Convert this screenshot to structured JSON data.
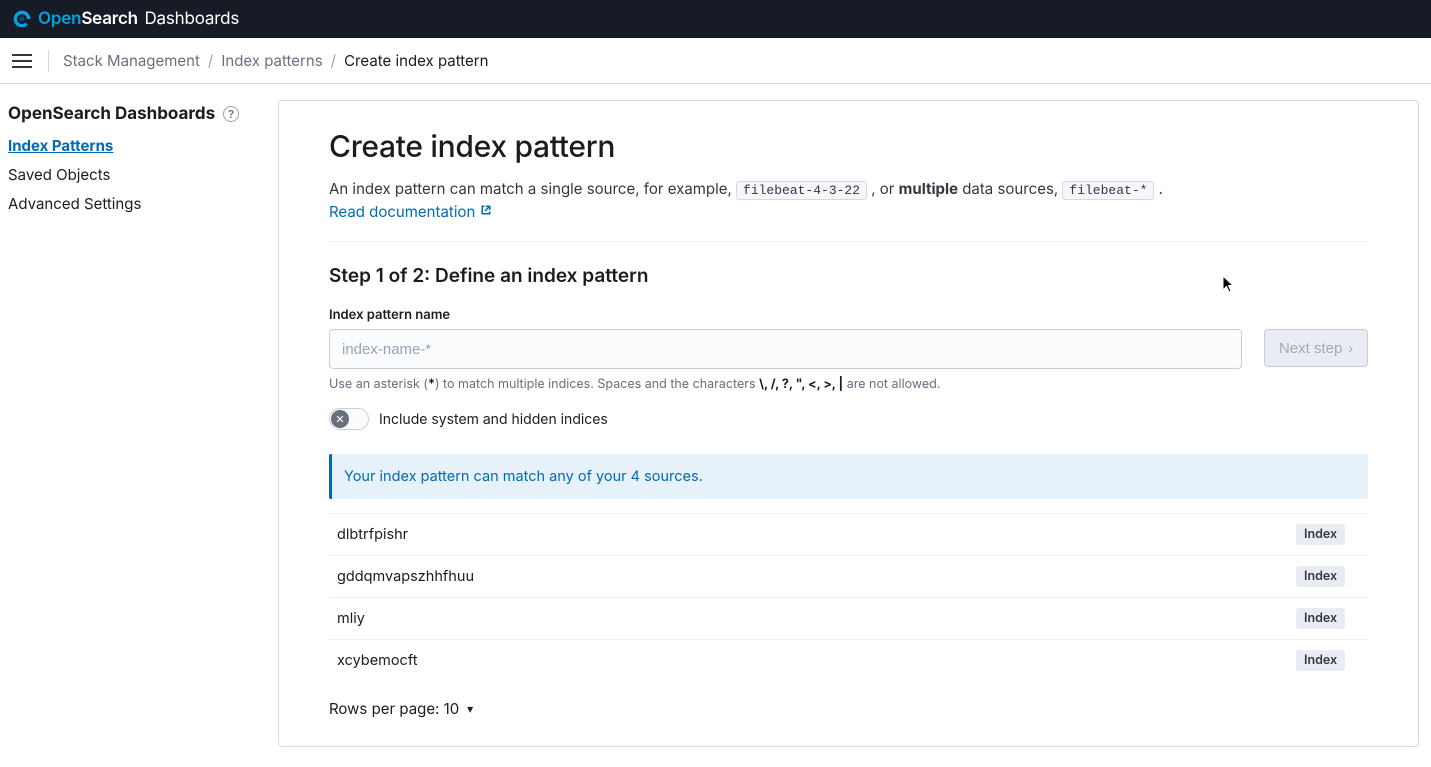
{
  "brand": {
    "open": "Open",
    "search": "Search",
    "dash": " Dashboards"
  },
  "breadcrumbs": {
    "items": [
      "Stack Management",
      "Index patterns"
    ],
    "current": "Create index pattern"
  },
  "sidebar": {
    "title": "OpenSearch Dashboards",
    "items": [
      {
        "label": "Index Patterns",
        "active": true
      },
      {
        "label": "Saved Objects",
        "active": false
      },
      {
        "label": "Advanced Settings",
        "active": false
      }
    ]
  },
  "page": {
    "title": "Create index pattern",
    "desc_pre": "An index pattern can match a single source, for example, ",
    "code1": "filebeat-4-3-22",
    "desc_mid": " , or ",
    "bold": "multiple",
    "desc_mid2": " data sources, ",
    "code2": "filebeat-*",
    "desc_end": " .",
    "doclink": "Read documentation",
    "step_title": "Step 1 of 2: Define an index pattern",
    "field_label": "Index pattern name",
    "placeholder": "index-name-*",
    "next_label": "Next step",
    "hint_pre": "Use an asterisk (",
    "hint_star": "*",
    "hint_mid": ") to match multiple indices. Spaces and the characters ",
    "hint_chars": "\\, /, ?, \", <, >, |",
    "hint_end": " are not allowed.",
    "toggle_label": "Include system and hidden indices",
    "callout": "Your index pattern can match any of your 4 sources.",
    "indices": [
      {
        "name": "dlbtrfpishr",
        "badge": "Index"
      },
      {
        "name": "gddqmvapszhhfhuu",
        "badge": "Index"
      },
      {
        "name": "mliy",
        "badge": "Index"
      },
      {
        "name": "xcybemocft",
        "badge": "Index"
      }
    ],
    "pager_label": "Rows per page: 10"
  }
}
